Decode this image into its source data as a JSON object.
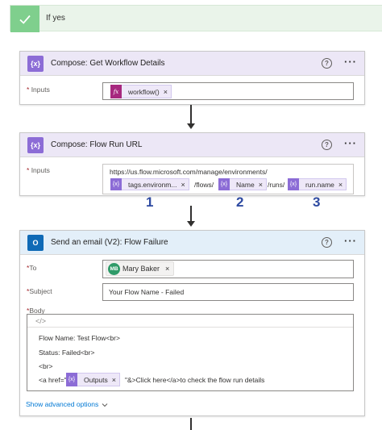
{
  "yes_branch": {
    "label": "If yes"
  },
  "compose_details": {
    "title": "Compose: Get Workflow Details",
    "inputs_label": "Inputs",
    "required_mark": "*",
    "token": {
      "icon": "fx",
      "label": "workflow()",
      "remove": "×"
    }
  },
  "compose_url": {
    "title": "Compose: Flow Run URL",
    "inputs_label": "Inputs",
    "required_mark": "*",
    "url_prefix": "https://us.flow.microsoft.com/manage/environments/",
    "tokens": [
      {
        "label": "tags.environm...",
        "remove": "×"
      },
      {
        "label": "Name",
        "remove": "×"
      },
      {
        "label": "run.name",
        "remove": "×"
      }
    ],
    "separators": [
      "/flows/",
      "/runs/"
    ],
    "annotations": [
      "1",
      "2",
      "3"
    ]
  },
  "send_email": {
    "title": "Send an email (V2): Flow Failure",
    "required_mark": "*",
    "to_label": "To",
    "recipient": {
      "initials": "MB",
      "name": "Mary Baker",
      "remove": "×"
    },
    "subject_label": "Subject",
    "subject_value": "Your Flow Name -  Failed",
    "body_label": "Body",
    "code_toggle": "</>",
    "body_lines": [
      "Flow Name: Test Flow<br>",
      "Status: Failed<br>",
      "<br>"
    ],
    "link_prefix": "<a href=\"",
    "outputs_token": {
      "label": "Outputs",
      "remove": "×"
    },
    "link_suffix": "\"&>Click here</a>to check the flow run details",
    "advanced_options": "Show advanced options"
  },
  "icons": {
    "help": "?",
    "more": "···",
    "compose_glyph": "{x}",
    "outlook_glyph": "O"
  },
  "colors": {
    "compose_accent": "#8c6cd6",
    "outlook_accent": "#0f6ab6",
    "yes_accent": "#7fcf8d",
    "annotation": "#2e4aa1",
    "link": "#0078d4"
  }
}
